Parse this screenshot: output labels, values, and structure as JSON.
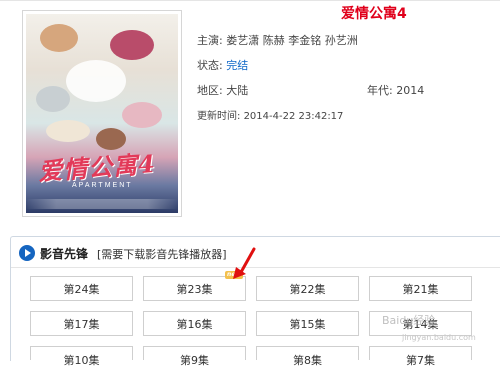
{
  "details": {
    "title": "爱情公寓4",
    "cast_label": "主演:",
    "cast_value": "娄艺潇 陈赫 李金铭 孙艺洲",
    "status_label": "状态:",
    "status_value": "完结",
    "region_label": "地区:",
    "region_value": "大陆",
    "year_label": "年代:",
    "year_value": "2014",
    "updated_label": "更新时间:",
    "updated_value": "2014-4-22 23:42:17"
  },
  "poster": {
    "title_text": "爱情公寓4",
    "subtitle_text": "APARTMENT"
  },
  "player_section": {
    "title": "影音先锋",
    "note": "[需要下载影音先锋播放器]",
    "new_badge": "new",
    "episodes": [
      "第24集",
      "第23集",
      "第22集",
      "第21集",
      "第17集",
      "第16集",
      "第15集",
      "第14集",
      "第10集",
      "第9集",
      "第8集",
      "第7集"
    ]
  },
  "watermark": {
    "text": "Baidu经验",
    "subtext": "jingyan.baidu.com"
  },
  "colors": {
    "title": "#e0001b",
    "link": "#0a65c7",
    "arrow": "#e01010",
    "section_border": "#cfd8e2"
  }
}
